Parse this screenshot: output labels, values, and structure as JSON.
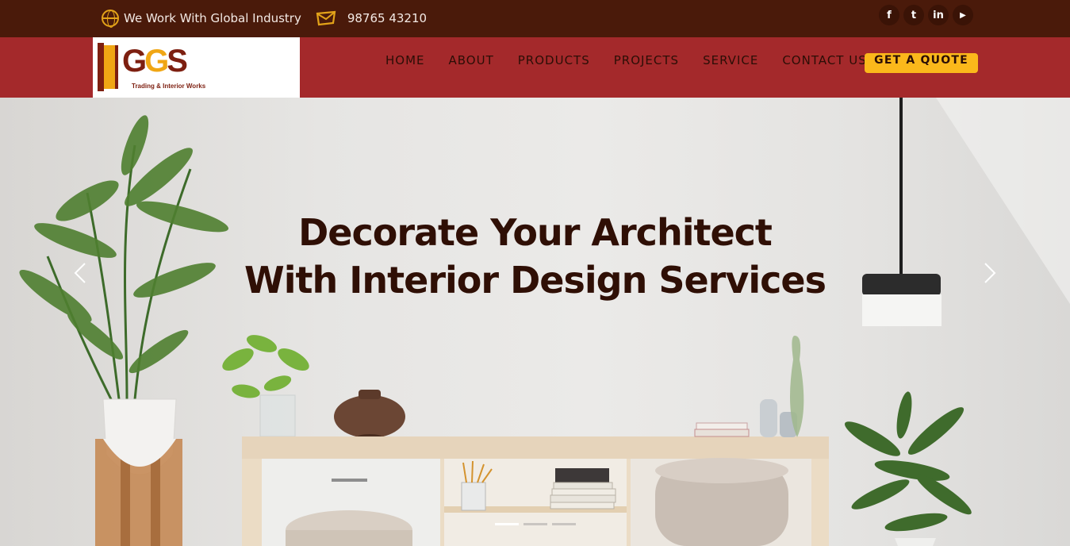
{
  "topbar": {
    "tagline": "We Work With Global Industry",
    "phone": "98765 43210",
    "social": [
      {
        "icon": "facebook-icon",
        "glyph": "f"
      },
      {
        "icon": "twitter-icon",
        "glyph": "t"
      },
      {
        "icon": "linkedin-icon",
        "glyph": "in"
      },
      {
        "icon": "youtube-icon",
        "glyph": "▶"
      }
    ]
  },
  "logo": {
    "letters_left": "G",
    "letters_mid": "G",
    "letters_right": "S",
    "tagline": "Trading & Interior Works"
  },
  "nav": {
    "items": [
      "HOME",
      "ABOUT",
      "PRODUCTS",
      "PROJECTS",
      "SERVICE",
      "CONTACT US"
    ],
    "cta": "GET A QUOTE"
  },
  "hero": {
    "title_line1": "Decorate Your Architect",
    "title_line2": "With Interior Design Services",
    "slide_count": 3,
    "active_slide": 1
  },
  "colors": {
    "topbar": "#4a1a0a",
    "header": "#a4292b",
    "accent": "#fbb81b",
    "title": "#2f0f05"
  }
}
